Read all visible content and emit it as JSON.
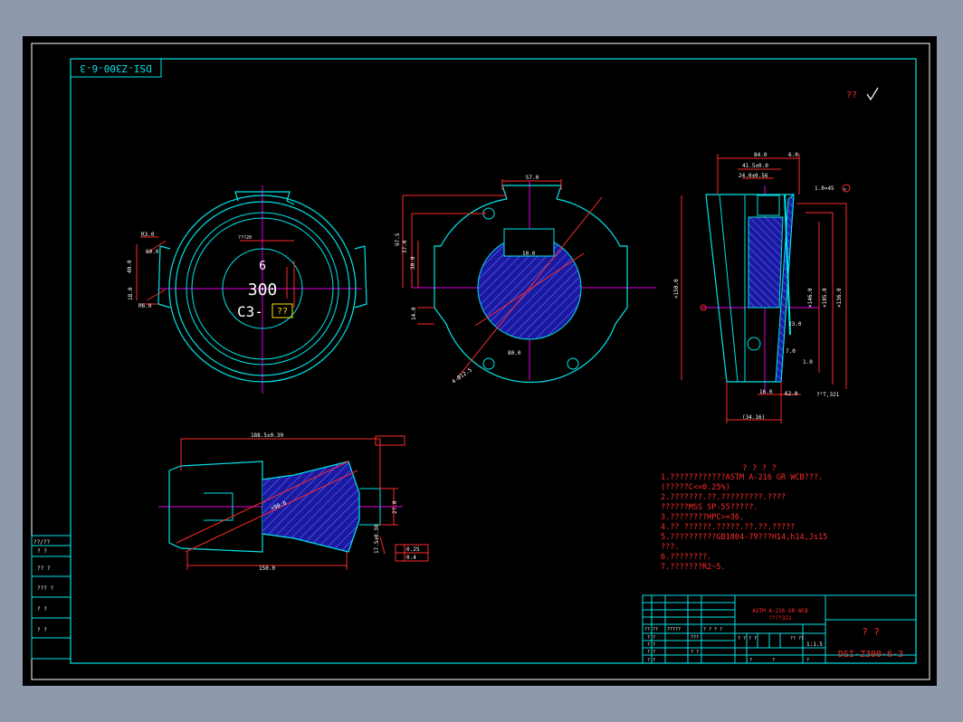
{
  "drawing": {
    "code_top": "DSI-Z300-6-3",
    "code_bottom": "DSI-Z300-6-3",
    "check_mark": "??",
    "left_strip": [
      "??/??",
      "? ?",
      "?? ?",
      "??? ?",
      "? ?",
      "? ?"
    ],
    "front_view": {
      "num_top": "6",
      "num_mid": "300",
      "num_bottom": "C3-",
      "box_text": "??",
      "dims": [
        "R3.0",
        "R6.0",
        "40.0",
        "60.0",
        "18.0",
        "???20"
      ]
    },
    "section_view": {
      "dims": [
        "57.0",
        "10.0",
        "30.0",
        "37.0",
        "97.5",
        "14.0",
        "80.0",
        "4-Ø12.5"
      ]
    },
    "side_view": {
      "dims": [
        "84.0",
        "41.5±0.0",
        "24.0±0.56",
        "6.0",
        "1.0×45",
        "×",
        "×146.0",
        "×105.0",
        "×136.0",
        "×150.0",
        "16.0",
        "62.0",
        "(34.16)",
        "?°T,321",
        "23.0",
        "7.0",
        "1.0"
      ]
    },
    "bottom_view": {
      "dims": [
        "188.5±0.30",
        "150.0",
        "2?.0",
        "17.5±0.30",
        "×90.0",
        "0.25",
        "0.4"
      ]
    },
    "notes_title": "? ? ? ?",
    "notes": [
      "1.????????????ASTM A-216 GR WCB???.",
      "  (?????C<=0.25%)",
      "2.???????.??.?????????.????",
      "  ??????MSS SP-55?????.",
      "3.????????HPC>=36.",
      "4.?? ??????.?????.??.??.?????",
      "5.??????????GB1804-79???H14,h14,Js15",
      "  ???.",
      "6.????????.",
      "7.???????R2~5."
    ],
    "title_block": {
      "material_1": "ASTM A-216 GR WCB",
      "material_2": "????321",
      "name": "? ?",
      "drawing_no": "DSI-Z300-6-3",
      "scale": "1:1.5",
      "cells": [
        "?? ??",
        "?????",
        "? ? ? ?",
        "? ?",
        "? ?",
        "???",
        "? ? ? ?",
        "?? ??",
        "? ?",
        "? ?",
        "? ?",
        "?",
        "?",
        "?"
      ]
    }
  },
  "colors": {
    "background": "#8e9aab",
    "sheet": "#000000",
    "cyan": "#00e5ea",
    "red": "#ff2a2a",
    "magenta": "#e000e0",
    "blue": "#3030ff",
    "yellow": "#ffe000",
    "white": "#ffffff"
  }
}
